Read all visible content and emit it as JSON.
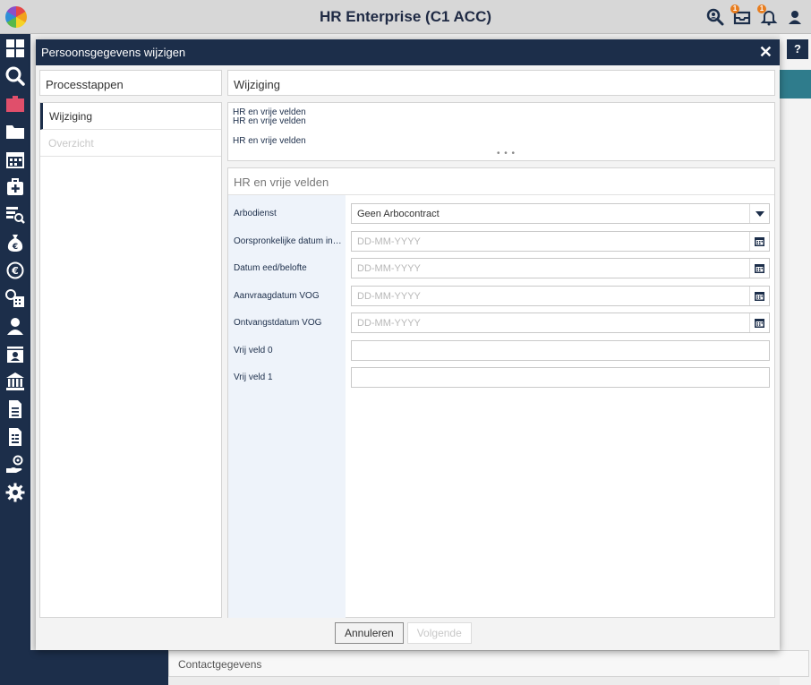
{
  "app": {
    "title": "HR Enterprise (C1 ACC)"
  },
  "top_icons": [
    {
      "name": "search-user-icon"
    },
    {
      "name": "inbox-icon",
      "badge": "1"
    },
    {
      "name": "bell-icon",
      "badge": "1"
    },
    {
      "name": "user-icon"
    }
  ],
  "sidebar": {
    "items": [
      {
        "name": "dashboard-icon"
      },
      {
        "name": "search-icon"
      },
      {
        "name": "id-card-icon",
        "active": true
      },
      {
        "name": "folder-icon"
      },
      {
        "name": "calendar-icon"
      },
      {
        "name": "medical-kit-icon"
      },
      {
        "name": "report-search-icon"
      },
      {
        "name": "money-bag-icon"
      },
      {
        "name": "euro-cycle-icon"
      },
      {
        "name": "calendar-clock-icon"
      },
      {
        "name": "person-icon"
      },
      {
        "name": "badge-icon"
      },
      {
        "name": "bank-icon"
      },
      {
        "name": "document-icon"
      },
      {
        "name": "document-list-icon"
      },
      {
        "name": "hand-coin-icon"
      },
      {
        "name": "gear-icon"
      }
    ]
  },
  "background": {
    "help_label": "?",
    "contact_label": "Contactgegevens"
  },
  "modal": {
    "title": "Persoonsgegevens wijzigen",
    "close_label": "✕",
    "steps_title": "Processtappen",
    "steps": [
      {
        "label": "Wijziging",
        "state": "active"
      },
      {
        "label": "Overzicht",
        "state": "disabled"
      }
    ],
    "main_title": "Wijziging",
    "summary": {
      "line1": "HR en vrije velden",
      "line2": "HR en vrije velden",
      "line3": "HR en vrije velden",
      "ellipsis": "• • •"
    },
    "form": {
      "title": "HR en vrije velden",
      "fields": [
        {
          "label": "Arbodienst",
          "value": "Geen Arbocontract",
          "type": "select"
        },
        {
          "label": "Oorspronkelijke datum in di...",
          "placeholder": "DD-MM-YYYY",
          "type": "date"
        },
        {
          "label": "Datum eed/belofte",
          "placeholder": "DD-MM-YYYY",
          "type": "date"
        },
        {
          "label": "Aanvraagdatum VOG",
          "placeholder": "DD-MM-YYYY",
          "type": "date"
        },
        {
          "label": "Ontvangstdatum VOG",
          "placeholder": "DD-MM-YYYY",
          "type": "date"
        },
        {
          "label": "Vrij veld 0",
          "value": "",
          "type": "text"
        },
        {
          "label": "Vrij veld 1",
          "value": "",
          "type": "text"
        }
      ]
    },
    "buttons": {
      "cancel": "Annuleren",
      "next": "Volgende"
    }
  },
  "colors": {
    "navy": "#1c2e4a",
    "accent": "#e04f6b",
    "badge": "#e87d1e",
    "teal": "#2f7c8c"
  }
}
